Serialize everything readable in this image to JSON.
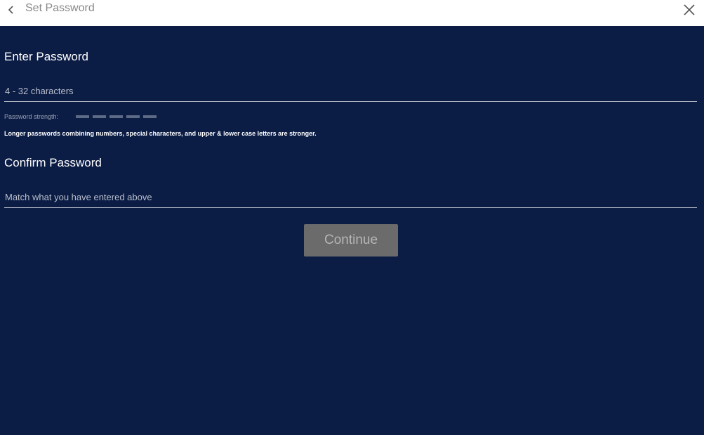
{
  "header": {
    "title": "Set Password",
    "back_icon": "chevron-left-icon",
    "close_icon": "close-icon"
  },
  "password": {
    "title": "Enter Password",
    "placeholder": "4 - 32 characters",
    "value": "",
    "strength_label": "Password strength:",
    "strength_segments": 5,
    "strength_level": 0,
    "hint": "Longer passwords combining numbers, special characters, and upper & lower case letters are stronger."
  },
  "confirm": {
    "title": "Confirm Password",
    "placeholder": "Match what you have entered above",
    "value": ""
  },
  "actions": {
    "continue_label": "Continue",
    "continue_enabled": false
  },
  "colors": {
    "background": "#0b1c45",
    "topbar": "#ffffff",
    "button_disabled": "#6b6b6b",
    "strength_empty": "#5d6a86"
  }
}
